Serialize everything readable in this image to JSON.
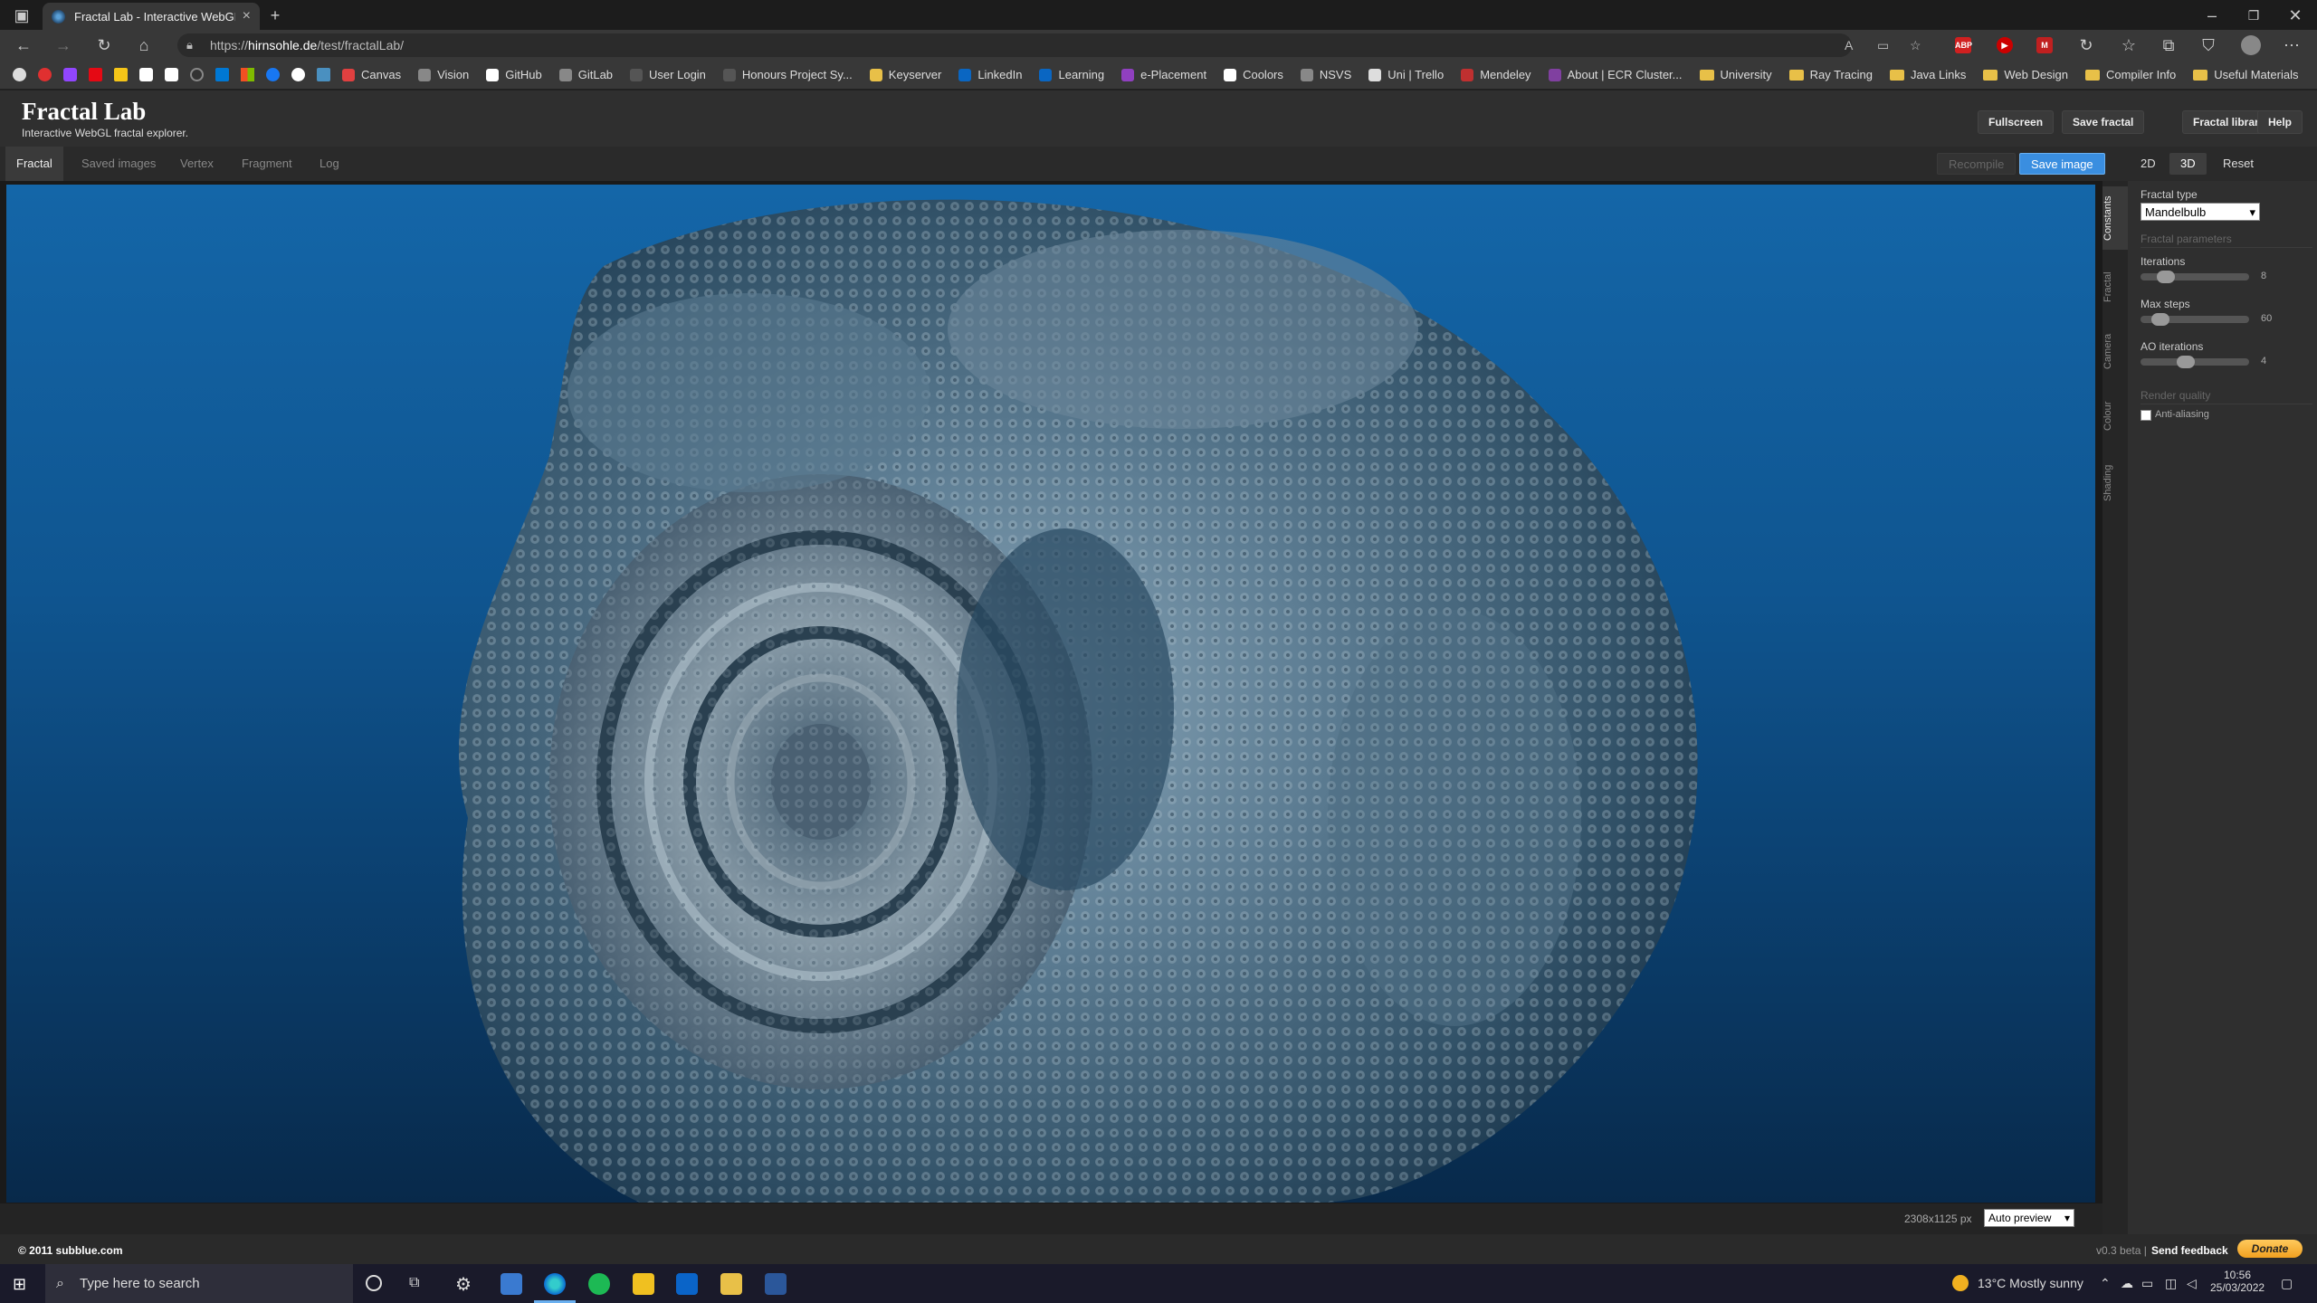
{
  "browser": {
    "tab_title": "Fractal Lab - Interactive WebGL F",
    "url_prefix": "https://",
    "url_domain": "hirnsohle.de",
    "url_path": "/test/fractalLab/",
    "bookmarks": [
      {
        "label": "Canvas",
        "color": "#e04040"
      },
      {
        "label": "Vision",
        "color": "#888888"
      },
      {
        "label": "GitHub",
        "color": "#ffffff"
      },
      {
        "label": "GitLab",
        "color": "#888888"
      },
      {
        "label": "User Login",
        "color": "#555555"
      },
      {
        "label": "Honours Project Sy...",
        "color": "#555555"
      },
      {
        "label": "Keyserver",
        "color": "#e8c048"
      },
      {
        "label": "LinkedIn",
        "color": "#0a66c2"
      },
      {
        "label": "Learning",
        "color": "#0a66c2"
      },
      {
        "label": "e-Placement",
        "color": "#9040c0"
      },
      {
        "label": "Coolors",
        "color": "#ffffff"
      },
      {
        "label": "NSVS",
        "color": "#888888"
      },
      {
        "label": "Uni | Trello",
        "color": "#dddddd"
      },
      {
        "label": "Mendeley",
        "color": "#c03030"
      },
      {
        "label": "About | ECR Cluster...",
        "color": "#8040a0"
      }
    ],
    "bookmark_folders": [
      "University",
      "Ray Tracing",
      "Java Links",
      "Web Design",
      "Compiler Info",
      "Useful Materials"
    ]
  },
  "app": {
    "title": "Fractal Lab",
    "subtitle": "Interactive WebGL fractal explorer.",
    "header_buttons": [
      "Fullscreen",
      "Save fractal",
      "Fractal library",
      "Help"
    ],
    "tabs": [
      "Fractal",
      "Saved images",
      "Vertex",
      "Fragment",
      "Log"
    ],
    "recompile": "Recompile",
    "save_image": "Save image",
    "mode_2d": "2D",
    "mode_3d": "3D",
    "reset": "Reset",
    "canvas_size": "2308x1125 px",
    "preview_mode": "Auto preview",
    "copyright": "© 2011 subblue.com",
    "version": "v0.3 beta |",
    "feedback": "Send feedback",
    "donate": "Donate"
  },
  "panel": {
    "vertical_tabs": [
      "Constants",
      "Fractal",
      "Camera",
      "Colour",
      "Shading"
    ],
    "fractal_type_label": "Fractal type",
    "fractal_type": "Mandelbulb",
    "section_params": "Fractal parameters",
    "params": [
      {
        "label": "Iterations",
        "value": "8",
        "level": 0.18
      },
      {
        "label": "Max steps",
        "value": "60",
        "level": 0.12
      },
      {
        "label": "AO iterations",
        "value": "4",
        "level": 0.4
      }
    ],
    "section_quality": "Render quality",
    "antialias_label": "Anti-aliasing"
  },
  "taskbar": {
    "search_placeholder": "Type here to search",
    "weather": "13°C  Mostly sunny",
    "time": "10:56",
    "date": "25/03/2022"
  },
  "colors": {
    "accent": "#3a8ee0",
    "donate": "#f0a020"
  }
}
